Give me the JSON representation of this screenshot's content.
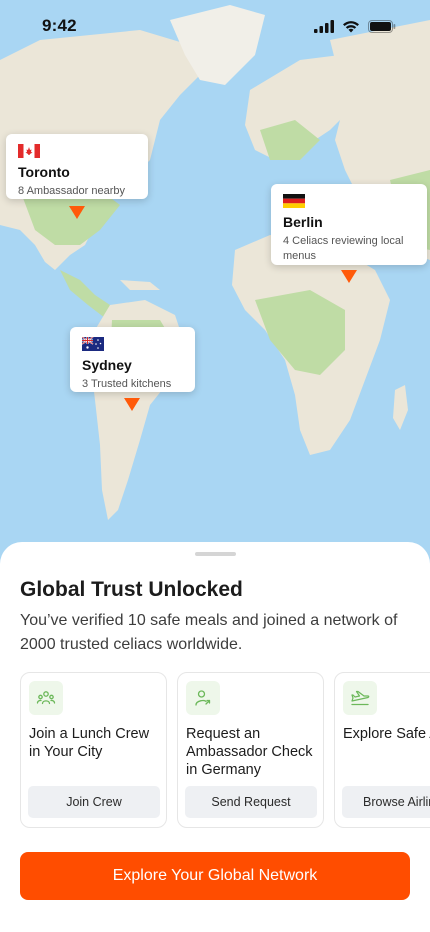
{
  "status_bar": {
    "time": "9:42"
  },
  "map": {
    "callouts": [
      {
        "flag": "canada-flag",
        "city": "Toronto",
        "subtitle": "8 Ambassador nearby"
      },
      {
        "flag": "germany-flag",
        "city": "Berlin",
        "subtitle": "4 Celiacs reviewing local menus"
      },
      {
        "flag": "australia-flag",
        "city": "Sydney",
        "subtitle": "3 Trusted kitchens"
      }
    ],
    "pin_color": "#ff5a0a"
  },
  "sheet": {
    "title": "Global Trust Unlocked",
    "description": "You’ve verified 10 safe meals and joined a network of 2000 trusted celiacs worldwide.",
    "cards": [
      {
        "icon": "group-icon",
        "title": "Join a Lunch Crew in Your City",
        "button": "Join Crew"
      },
      {
        "icon": "user-check-icon",
        "title": "Request an Ambassador Check in Germany",
        "button": "Send Request"
      },
      {
        "icon": "airplane-icon",
        "title": "Explore Safe Airlines",
        "button": "Browse Airlines"
      }
    ],
    "cta": "Explore Your Global Network"
  },
  "colors": {
    "accent": "#ff4d00",
    "icon_bg": "#eef7ea",
    "icon_green": "#6cb85a",
    "ocean": "#a9d6f3",
    "land": "#ebe6d8",
    "forest": "#bfdca5"
  }
}
